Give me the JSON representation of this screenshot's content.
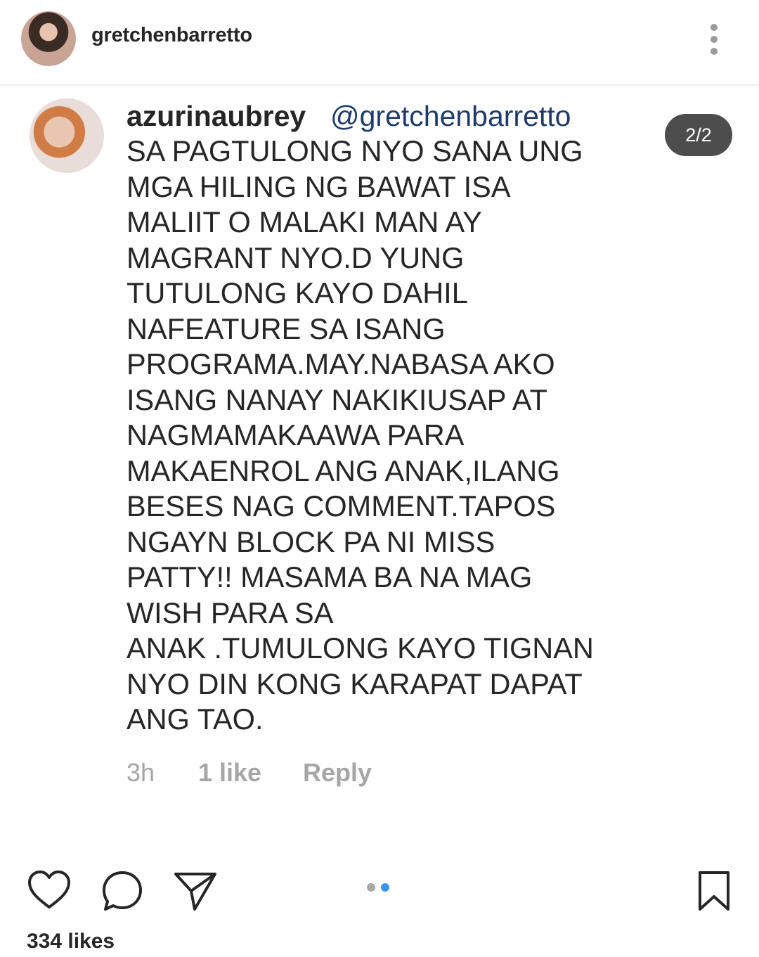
{
  "header": {
    "username": "gretchenbarretto",
    "avatar_icon": "profile-photo",
    "more_icon": "more-vertical-icon"
  },
  "comment": {
    "author": "azurinaubrey",
    "mention": "@gretchenbarretto",
    "avatar_icon": "profile-photo",
    "text": "SA PAGTULONG NYO SANA UNG\nMGA HILING NG BAWAT ISA\nMALIIT O MALAKI MAN AY\nMAGRANT NYO.D YUNG\nTUTULONG KAYO DAHIL\nNAFEATURE SA ISANG\nPROGRAMA.MAY.NABASA AKO\nISANG NANAY NAKIKIUSAP AT\nNAGMAMAKAAWA PARA\nMAKAENROL ANG ANAK,ILANG\nBESES NAG COMMENT.TAPOS\nNGAYN BLOCK PA NI MISS\nPATTY!! MASAMA BA NA MAG\nWISH PARA SA\nANAK .TUMULONG KAYO TIGNAN\nNYO DIN KONG KARAPAT DAPAT\nANG TAO.",
    "time": "3h",
    "likes": "1 like",
    "reply": "Reply"
  },
  "carousel": {
    "counter": "2/2",
    "total": 2,
    "current": 2
  },
  "actions": {
    "like_icon": "heart-icon",
    "comment_icon": "comment-bubble-icon",
    "share_icon": "paper-plane-icon",
    "save_icon": "bookmark-icon"
  },
  "likes_count": "334 likes",
  "colors": {
    "text": "#262626",
    "muted": "#a6a6a6",
    "mention": "#1f3b6b",
    "active_dot": "#3897f0",
    "inactive_dot": "#a8a8a8"
  }
}
